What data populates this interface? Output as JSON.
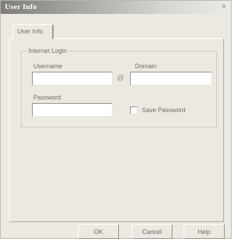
{
  "window": {
    "title": "User Info",
    "close_glyph": "×"
  },
  "tabs": [
    {
      "label": "User Info",
      "selected": true
    }
  ],
  "group": {
    "label": "Internet Login"
  },
  "fields": {
    "username": {
      "label": "Username",
      "value": ""
    },
    "domain": {
      "label": "Domain",
      "value": ""
    },
    "password": {
      "label": "Password",
      "value": ""
    },
    "separator": "@"
  },
  "save_password": {
    "label": "Save Password",
    "checked": false
  },
  "buttons": {
    "ok": "OK",
    "cancel": "Cancel",
    "help": "Help"
  },
  "colors": {
    "dialog_bg": "#ece9e1",
    "label_text": "#6f6c66",
    "title_text": "#ffffff"
  }
}
